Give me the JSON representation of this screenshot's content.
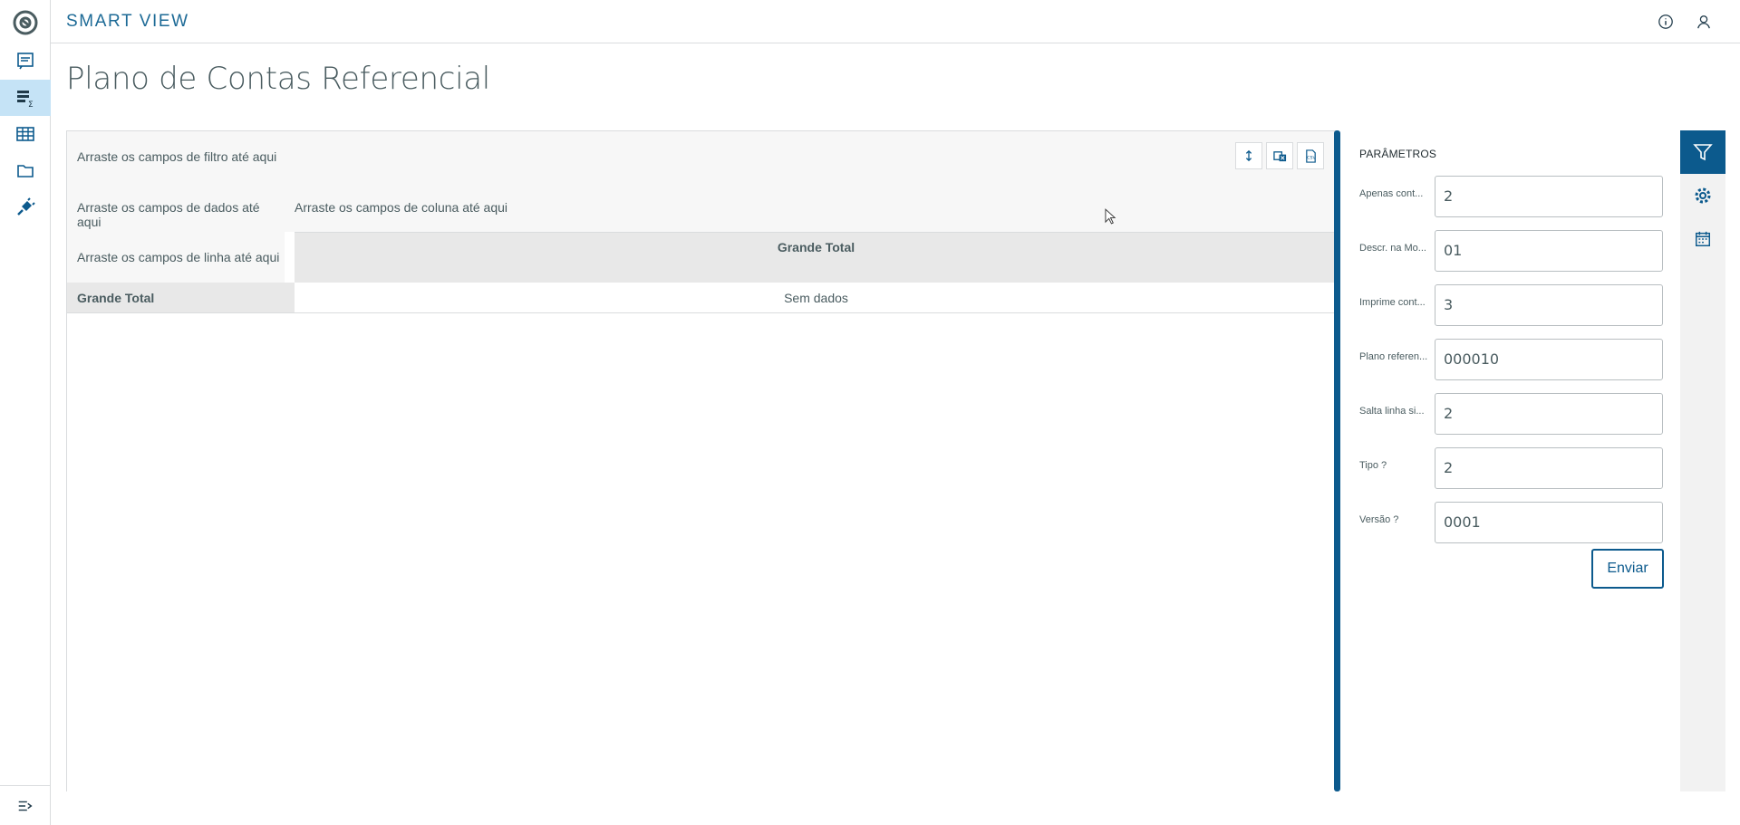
{
  "app": {
    "brand": "SMART VIEW"
  },
  "page": {
    "title": "Plano de Contas Referencial"
  },
  "pivot": {
    "filter_drop": "Arraste os campos de filtro até aqui",
    "data_drop": "Arraste os campos de dados até aqui",
    "column_drop": "Arraste os campos de coluna até aqui",
    "row_drop": "Arraste os campos de linha até aqui",
    "column_total": "Grande Total",
    "row_total": "Grande Total",
    "empty_cell": "Sem dados"
  },
  "params": {
    "title": "PARÂMETROS",
    "fields": [
      {
        "label": "Apenas cont...",
        "value": "2"
      },
      {
        "label": "Descr. na Mo...",
        "value": "01"
      },
      {
        "label": "Imprime cont...",
        "value": "3"
      },
      {
        "label": "Plano referen...",
        "value": "000010"
      },
      {
        "label": "Salta linha si...",
        "value": "2"
      },
      {
        "label": "Tipo ?",
        "value": "2"
      },
      {
        "label": "Versão ?",
        "value": "0001"
      }
    ],
    "submit_label": "Enviar"
  },
  "colors": {
    "accent": "#0c5a8d",
    "brand": "#1d6a96",
    "active_nav": "#c5e3f6"
  }
}
